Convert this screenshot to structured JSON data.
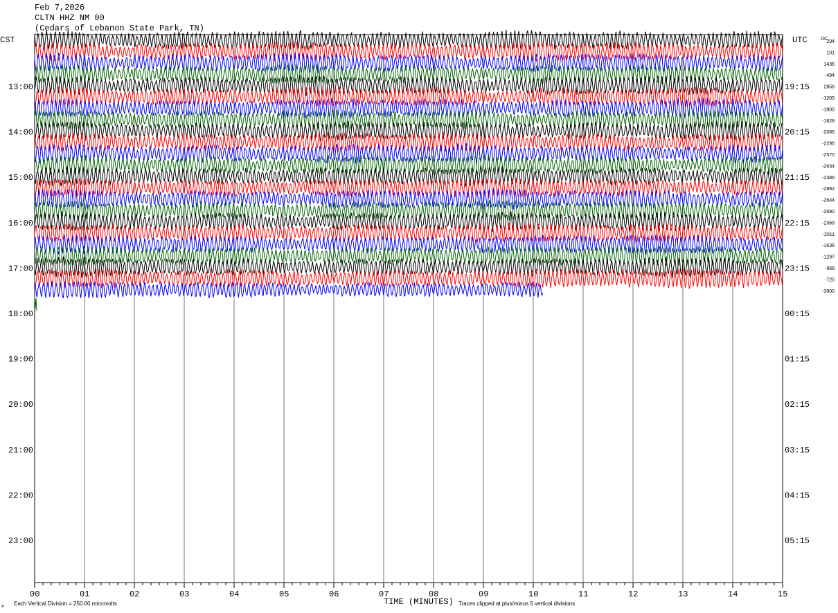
{
  "header": {
    "date": "Feb 7,2026",
    "station": "CLTN HHZ NM 00",
    "location": "(Cedars of Lebanon State Park, TN)"
  },
  "axis_labels": {
    "left_zone": "CST",
    "right_zone": "UTC",
    "dc_label": "DC",
    "x_title": "TIME (MINUTES)"
  },
  "footer": {
    "scale_note": "Each Vertical Division =  250.00 microvolts",
    "clip_note": "Traces clipped at plus/minus 5 vertical divisions",
    "corner_mark": "A"
  },
  "chart_data": {
    "type": "line",
    "title": "CLTN HHZ NM 00",
    "xlabel": "TIME (MINUTES)",
    "x_range": [
      0,
      15
    ],
    "x_ticks": [
      "00",
      "01",
      "02",
      "03",
      "04",
      "05",
      "06",
      "07",
      "08",
      "09",
      "10",
      "11",
      "12",
      "13",
      "14",
      "15"
    ],
    "left_hour_labels": [
      "13:00",
      "14:00",
      "15:00",
      "16:00",
      "17:00",
      "18:00",
      "19:00",
      "20:00",
      "21:00",
      "22:00",
      "23:00"
    ],
    "right_hour_labels": [
      "19:15",
      "20:15",
      "21:15",
      "22:15",
      "23:15",
      "00:15",
      "01:15",
      "02:15",
      "03:15",
      "04:15",
      "05:15"
    ],
    "trace_interval_minutes": 15,
    "trace_colors": [
      "#000000",
      "#ff0000",
      "#0000ff",
      "#006400"
    ],
    "dc_offsets": [
      "294",
      "101",
      "1436",
      "-494",
      "2856",
      "-1205",
      "-1800",
      "-1828",
      "-2086",
      "-2296",
      "-2570",
      "-2634",
      "-2386",
      "-2892",
      "-2644",
      "-2690",
      "-2369",
      "-2011",
      "-1636",
      "-1297",
      "-968",
      "-725",
      "-3800"
    ],
    "traces": [
      {
        "start_minute": 0,
        "end_minute": 15,
        "amplitude": 0.55
      },
      {
        "start_minute": 0,
        "end_minute": 15,
        "amplitude": 0.55
      },
      {
        "start_minute": 0,
        "end_minute": 15,
        "amplitude": 0.55
      },
      {
        "start_minute": 0,
        "end_minute": 15,
        "amplitude": 0.55
      },
      {
        "start_minute": 0,
        "end_minute": 15,
        "amplitude": 0.55
      },
      {
        "start_minute": 0,
        "end_minute": 15,
        "amplitude": 0.55
      },
      {
        "start_minute": 0,
        "end_minute": 15,
        "amplitude": 0.55
      },
      {
        "start_minute": 0,
        "end_minute": 15,
        "amplitude": 0.55
      },
      {
        "start_minute": 0,
        "end_minute": 15,
        "amplitude": 0.55
      },
      {
        "start_minute": 0,
        "end_minute": 15,
        "amplitude": 0.55
      },
      {
        "start_minute": 0,
        "end_minute": 15,
        "amplitude": 0.55
      },
      {
        "start_minute": 0,
        "end_minute": 15,
        "amplitude": 0.55
      },
      {
        "start_minute": 0,
        "end_minute": 15,
        "amplitude": 0.55
      },
      {
        "start_minute": 0,
        "end_minute": 15,
        "amplitude": 0.55
      },
      {
        "start_minute": 0,
        "end_minute": 15,
        "amplitude": 0.55
      },
      {
        "start_minute": 0,
        "end_minute": 15,
        "amplitude": 0.55
      },
      {
        "start_minute": 0,
        "end_minute": 15,
        "amplitude": 0.55
      },
      {
        "start_minute": 0,
        "end_minute": 15,
        "amplitude": 0.55
      },
      {
        "start_minute": 0,
        "end_minute": 15,
        "amplitude": 0.55
      },
      {
        "start_minute": 0,
        "end_minute": 15,
        "amplitude": 0.55
      },
      {
        "start_minute": 0,
        "end_minute": 15,
        "amplitude": 0.55
      },
      {
        "start_minute": 0,
        "end_minute": 15,
        "amplitude": 0.55
      },
      {
        "start_minute": 0,
        "end_minute": 10.2,
        "amplitude": 0.5
      },
      {
        "start_minute": 0,
        "end_minute": 0.05,
        "amplitude": 0.3
      }
    ],
    "grid": true
  }
}
